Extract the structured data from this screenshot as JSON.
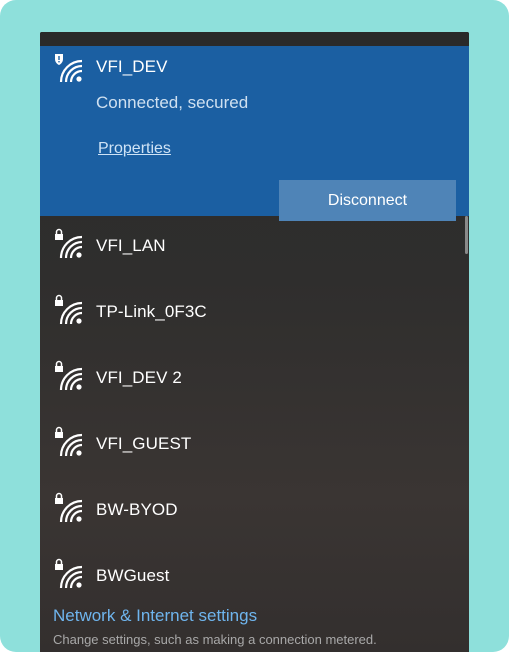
{
  "colors": {
    "backdrop": "#8ee0db",
    "connected_bg": "#1b5fa2",
    "disconnect_bg": "#4f84b7",
    "link": "#6fb5ee"
  },
  "connected_network": {
    "name": "VFI_DEV",
    "status": "Connected, secured",
    "icon": "wifi-secured-shield-icon",
    "properties_label": "Properties",
    "disconnect_label": "Disconnect"
  },
  "networks": [
    {
      "name": "VFI_LAN",
      "icon": "wifi-locked-icon"
    },
    {
      "name": "TP-Link_0F3C",
      "icon": "wifi-locked-icon"
    },
    {
      "name": "VFI_DEV 2",
      "icon": "wifi-locked-icon"
    },
    {
      "name": "VFI_GUEST",
      "icon": "wifi-locked-icon"
    },
    {
      "name": "BW-BYOD",
      "icon": "wifi-locked-icon"
    },
    {
      "name": "BWGuest",
      "icon": "wifi-locked-icon"
    }
  ],
  "footer": {
    "settings_link": "Network & Internet settings",
    "settings_description": "Change settings, such as making a connection metered."
  }
}
